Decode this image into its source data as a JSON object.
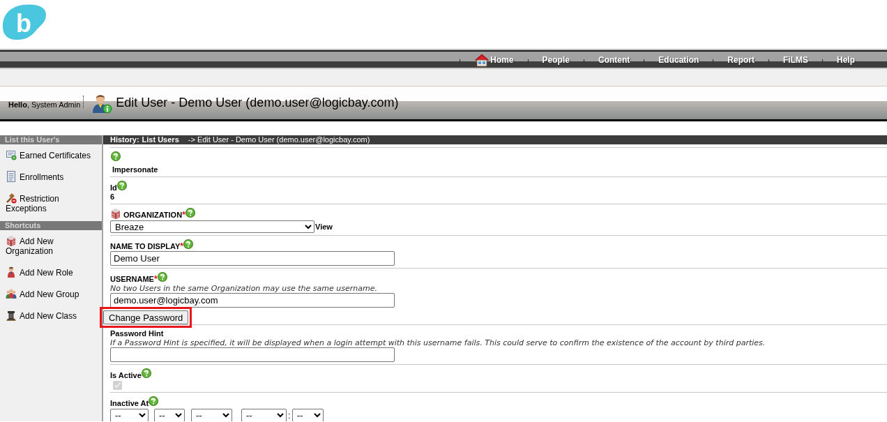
{
  "logo": {
    "text": "b"
  },
  "nav": [
    {
      "label": "Home",
      "kind": "home"
    },
    {
      "label": "People",
      "kind": "plain"
    },
    {
      "label": "Content",
      "kind": "plain"
    },
    {
      "label": "Education",
      "kind": "plain"
    },
    {
      "label": "Report",
      "kind": "plain"
    },
    {
      "label": "FiLMS",
      "kind": "plain"
    },
    {
      "label": "Help",
      "kind": "plain"
    }
  ],
  "header": {
    "greeting": "**Hello**, System Admin",
    "title": "Edit User - Demo User (demo.user@logicbay.com)"
  },
  "sidebar": [
    {
      "title": "List this User's",
      "items": [
        {
          "label": "Earned Certificates",
          "kind": "certificate"
        },
        {
          "label": "Enrollments",
          "kind": "enrollment"
        },
        {
          "label": "Restriction Exceptions",
          "kind": "restriction"
        }
      ]
    },
    {
      "title": "Shortcuts",
      "items": [
        {
          "label": "Add New Organization",
          "kind": "organization"
        },
        {
          "label": "Add New Role",
          "kind": "role"
        },
        {
          "label": "Add New Group",
          "kind": "group"
        },
        {
          "label": "Add New Class",
          "kind": "class"
        }
      ]
    }
  ],
  "breadcrumb": {
    "label": "History:",
    "link": "List Users",
    "current": "-> Edit User - Demo User (demo.user@logicbay.com)"
  },
  "form": [
    {
      "kind": "action",
      "label": "Impersonate",
      "help": true
    },
    {
      "kind": "readonly",
      "label": "Id",
      "help": true,
      "value": "6"
    },
    {
      "kind": "organization",
      "label": "ORGANIZATION",
      "required_mark": "*",
      "help": true,
      "value": "Breaze",
      "link": "View"
    },
    {
      "kind": "text",
      "label": "NAME TO DISPLAY",
      "required_mark": "*",
      "help": true,
      "value": "Demo User"
    },
    {
      "kind": "text",
      "label": "USERNAME",
      "required_mark": "*",
      "help": true,
      "note": "No two Users in the same Organization may use the same username.",
      "value": "demo.user@logicbay.com",
      "button": {
        "label": "Change Password",
        "highlighted": true
      }
    },
    {
      "kind": "text",
      "label": "Password Hint",
      "help": false,
      "note": "If a Password Hint is specified, it will be displayed when a login attempt with this username fails. This could serve to confirm the existence of the account by third parties."
    },
    {
      "kind": "checkbox",
      "label": "Is Active",
      "help": true,
      "checked": true,
      "disabled": true
    },
    {
      "kind": "datetime",
      "label": "Inactive At",
      "help": true,
      "date": [
        "--",
        "--",
        "--"
      ],
      "time_separator": ":",
      "time": [
        "--",
        "--"
      ]
    }
  ]
}
